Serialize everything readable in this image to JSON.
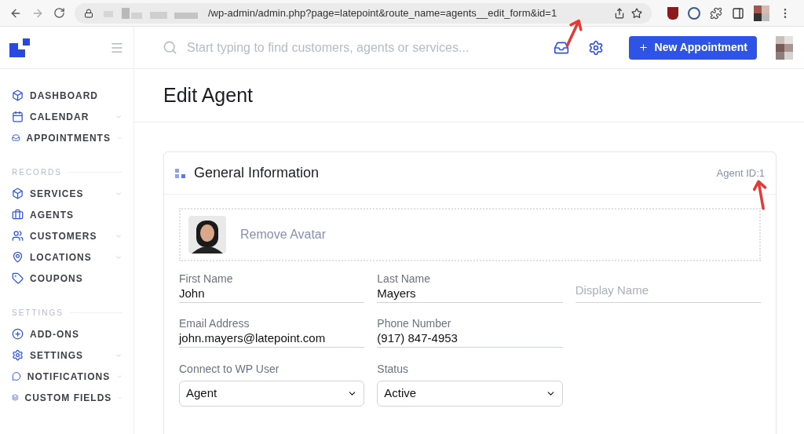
{
  "browser": {
    "url": "/wp-admin/admin.php?page=latepoint&route_name=agents__edit_form&id=1"
  },
  "header": {
    "search": {
      "placeholder": "Start typing to find customers, agents or services..."
    },
    "new_button": "New Appointment"
  },
  "sidebar": {
    "sections": [
      {
        "items": [
          {
            "label": "DASHBOARD",
            "expandable": false
          },
          {
            "label": "CALENDAR",
            "expandable": true
          },
          {
            "label": "APPOINTMENTS",
            "expandable": true
          }
        ]
      },
      {
        "title": "RECORDS",
        "items": [
          {
            "label": "SERVICES",
            "expandable": true
          },
          {
            "label": "AGENTS",
            "expandable": false
          },
          {
            "label": "CUSTOMERS",
            "expandable": true
          },
          {
            "label": "LOCATIONS",
            "expandable": true
          },
          {
            "label": "COUPONS",
            "expandable": false
          }
        ]
      },
      {
        "title": "SETTINGS",
        "items": [
          {
            "label": "ADD-ONS",
            "expandable": false
          },
          {
            "label": "SETTINGS",
            "expandable": true
          },
          {
            "label": "NOTIFICATIONS",
            "expandable": true
          },
          {
            "label": "CUSTOM FIELDS",
            "expandable": true
          }
        ]
      }
    ]
  },
  "page_title": "Edit Agent",
  "card": {
    "title": "General Information",
    "agent_id": "Agent ID:1",
    "remove_avatar": "Remove Avatar",
    "fields": [
      {
        "kind": "text",
        "label": "First Name",
        "value": "John"
      },
      {
        "kind": "text",
        "label": "Last Name",
        "value": "Mayers"
      },
      {
        "kind": "text",
        "placeholder": "Display Name"
      },
      {
        "kind": "text",
        "label": "Email Address",
        "value": "john.mayers@latepoint.com"
      },
      {
        "kind": "text",
        "label": "Phone Number",
        "value": "(917) 847-4953"
      },
      {
        "kind": "empty"
      },
      {
        "kind": "select",
        "label": "Connect to WP User",
        "value": "Agent"
      },
      {
        "kind": "select",
        "label": "Status",
        "value": "Active"
      }
    ]
  }
}
